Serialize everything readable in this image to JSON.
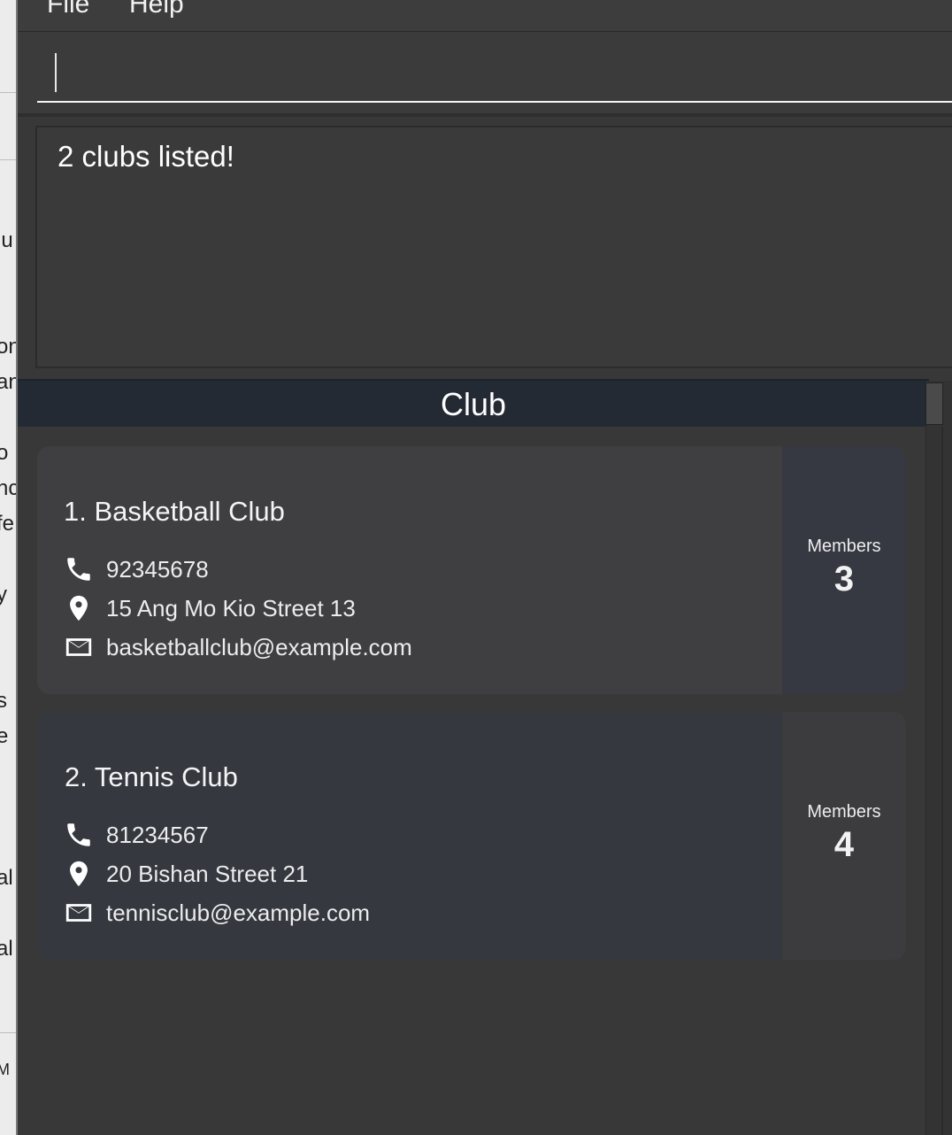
{
  "menu": {
    "items": [
      "File",
      "Help"
    ]
  },
  "command_box": {
    "value": ""
  },
  "result_display": {
    "text": "2 clubs listed!"
  },
  "club_list": {
    "header": "Club",
    "clubs": [
      {
        "index_name": "1. Basketball Club",
        "phone": "92345678",
        "address": "15 Ang Mo Kio Street 13",
        "email": "basketballclub@example.com",
        "members_label": "Members",
        "members_count": "3"
      },
      {
        "index_name": "2. Tennis Club",
        "phone": "81234567",
        "address": "20 Bishan Street 21",
        "email": "tennisclub@example.com",
        "members_label": "Members",
        "members_count": "4"
      }
    ]
  },
  "background_window": {
    "fragments": [
      "lu",
      "on",
      "an",
      "o",
      "nc",
      "fe",
      "y",
      "s",
      "e",
      "al",
      "al",
      "M"
    ]
  },
  "icons": {
    "phone": "phone-icon",
    "address": "location-pin-icon",
    "email": "envelope-icon"
  }
}
